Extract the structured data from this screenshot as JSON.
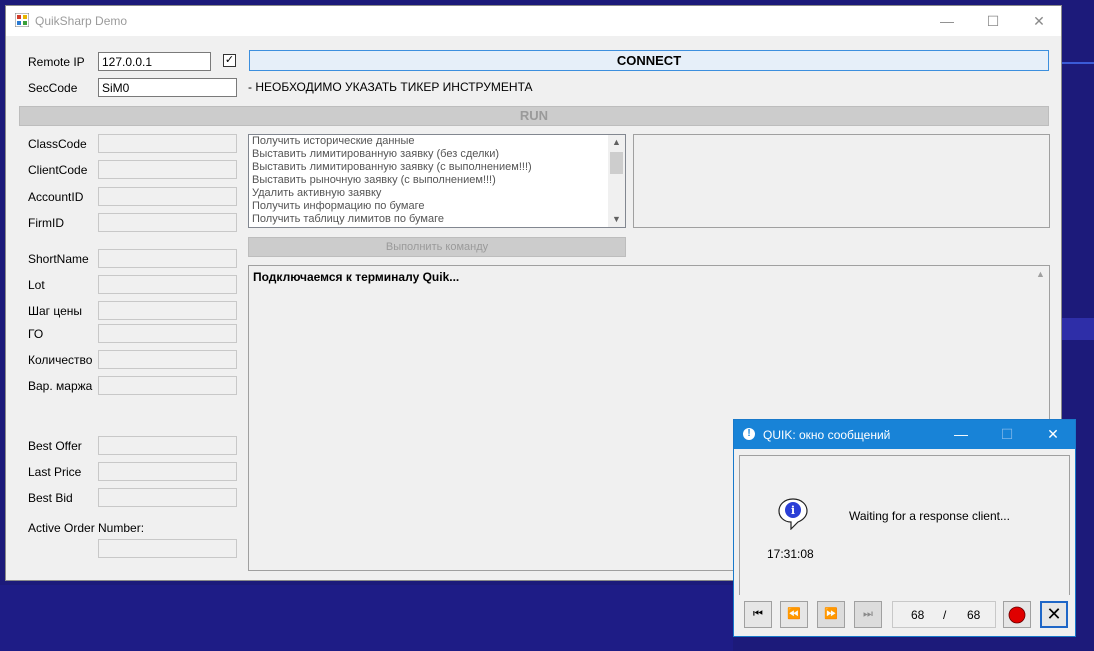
{
  "window": {
    "title": "QuikSharp Demo",
    "min_glyph": "—",
    "max_glyph": "☐",
    "close_glyph": "✕"
  },
  "connection": {
    "remote_ip_label": "Remote IP",
    "remote_ip_value": "127.0.0.1",
    "checkbox_checked": true,
    "checkbox_glyph": "✓",
    "connect_label": "CONNECT",
    "seccode_label": "SecCode",
    "seccode_value": "SiM0",
    "notice": "- НЕОБХОДИМО УКАЗАТЬ ТИКЕР ИНСТРУМЕНТА"
  },
  "run_label": "RUN",
  "fields": {
    "classcode": "ClassCode",
    "clientcode": "ClientCode",
    "accountid": "AccountID",
    "firmid": "FirmID",
    "shortname": "ShortName",
    "lot": "Lot",
    "price_step": "Шаг цены",
    "go": "ГО",
    "quantity": "Количество",
    "var_margin": "Вар. маржа",
    "best_offer": "Best Offer",
    "last_price": "Last Price",
    "best_bid": "Best Bid",
    "active_order": "Active Order Number:"
  },
  "commands": [
    "Получить исторические данные",
    "Выставить лимитированную заявку (без сделки)",
    "Выставить лимитированную заявку (с выполнением!!!)",
    "Выставить рыночную заявку (с выполнением!!!)",
    "Удалить активную заявку",
    "Получить информацию по бумаге",
    "Получить таблицу лимитов по бумаге"
  ],
  "scroll": {
    "up": "▲",
    "down": "▼"
  },
  "execute_label": "Выполнить команду",
  "log_text": "Подключаемся к терминалу Quik...",
  "quik_dialog": {
    "title": "QUIK: окно сообщений",
    "icon_glyph": "!",
    "min_glyph": "—",
    "max_glyph": "☐",
    "close_glyph": "✕",
    "message": "Waiting for a response client...",
    "time": "17:31:08",
    "info_glyph": "i",
    "nav_first": "⏮",
    "nav_prev": "⏪",
    "nav_next": "⏩",
    "nav_last": "⏭",
    "current": "68",
    "separator": "/",
    "total": "68",
    "dismiss_glyph": "✕"
  },
  "colors": {
    "accent_blue": "#1883d7",
    "connect_border": "#3c8fde",
    "record_red": "#e00000"
  }
}
